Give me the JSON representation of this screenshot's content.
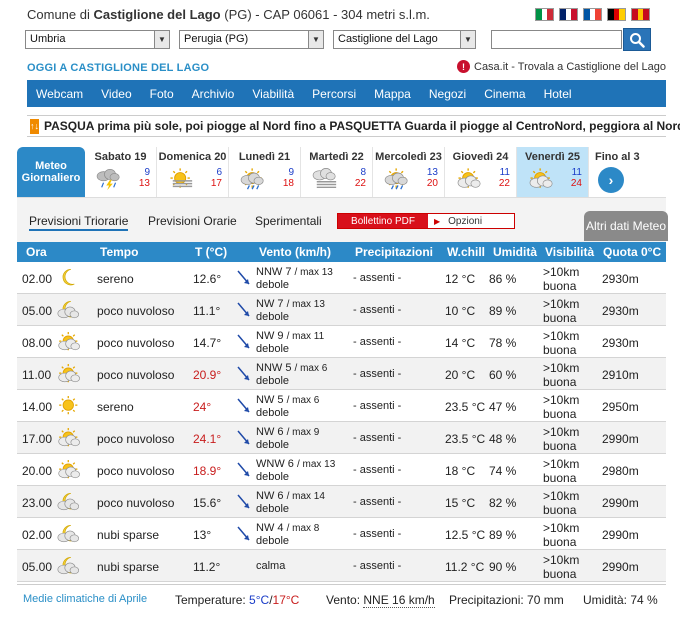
{
  "header": {
    "comune_prefix": "Comune di",
    "comune_name": "Castiglione del Lago",
    "suffix": "(PG) - CAP 06061 - 304 metri s.l.m."
  },
  "flags": [
    {
      "name": "italian-flag",
      "colors": [
        "#009246",
        "#ffffff",
        "#ce2b37"
      ]
    },
    {
      "name": "uk-flag",
      "colors": [
        "#012169",
        "#ffffff",
        "#c8102e"
      ]
    },
    {
      "name": "french-flag",
      "colors": [
        "#0055a4",
        "#ffffff",
        "#ef4135"
      ]
    },
    {
      "name": "german-flag",
      "colors": [
        "#000000",
        "#dd0000",
        "#ffce00"
      ]
    },
    {
      "name": "spanish-flag",
      "colors": [
        "#c60b1e",
        "#ffc400",
        "#c60b1e"
      ]
    }
  ],
  "selects": {
    "region": "Umbria",
    "province": "Perugia (PG)",
    "comune": "Castiglione del Lago"
  },
  "search": {
    "value": ""
  },
  "oggi_title": "OGGI A CASTIGLIONE DEL LAGO",
  "casa_link": "Casa.it - Trovala a Castiglione del Lago",
  "nav": [
    "Webcam",
    "Video",
    "Foto",
    "Archivio",
    "Viabilità",
    "Percorsi",
    "Mappa",
    "Negozi",
    "Cinema",
    "Hotel"
  ],
  "news": {
    "text": "PASQUA prima più sole, poi piogge al Nord fino a PASQUETTA Guarda il piogge al CentroNord, peggiora al Nord"
  },
  "days": {
    "meteo_tab": "Meteo Giornaliero",
    "list": [
      {
        "name": "Sabato 19",
        "min": "9",
        "max": "13",
        "icon": "thunderstorm-icon"
      },
      {
        "name": "Domenica 20",
        "min": "6",
        "max": "17",
        "icon": "sun-fog-icon"
      },
      {
        "name": "Lunedì 21",
        "min": "9",
        "max": "18",
        "icon": "rain-icon"
      },
      {
        "name": "Martedì 22",
        "min": "8",
        "max": "22",
        "icon": "fog-icon"
      },
      {
        "name": "Mercoledì 23",
        "min": "13",
        "max": "20",
        "icon": "rain-icon"
      },
      {
        "name": "Giovedì 24",
        "min": "11",
        "max": "22",
        "icon": "partly-cloudy-icon"
      },
      {
        "name": "Venerdì 25",
        "min": "11",
        "max": "24",
        "icon": "partly-cloudy-icon",
        "selected": true
      }
    ],
    "fino": "Fino al 3"
  },
  "subtabs": {
    "triorarie": "Previsioni Triorarie",
    "orarie": "Previsioni Orarie",
    "sperimentali": "Sperimentali",
    "bollettino": "Bollettino PDF",
    "opzioni": "Opzioni",
    "altri": "Altri dati Meteo"
  },
  "columns": {
    "ora": "Ora",
    "tempo": "Tempo",
    "temp": "T (°C)",
    "vento": "Vento (km/h)",
    "prec": "Precipitazioni",
    "wchill": "W.chill",
    "umidita": "Umidità",
    "visibilita": "Visibilità",
    "quota": "Quota 0°C"
  },
  "rows": [
    {
      "ora": "02.00",
      "icon": "moon-icon",
      "tempo": "sereno",
      "temp": "12.6°",
      "warm": false,
      "dir": "NNW 7",
      "max": "/ max 13",
      "forza": "debole",
      "prec": "- assenti -",
      "wc": "12 °C",
      "umi": "86 %",
      "vis": ">10km",
      "vis2": "buona",
      "quota": "2930m"
    },
    {
      "ora": "05.00",
      "icon": "cloudy-moon-icon",
      "tempo": "poco nuvoloso",
      "temp": "11.1°",
      "warm": false,
      "dir": "NW 7",
      "max": "/ max 13",
      "forza": "debole",
      "prec": "- assenti -",
      "wc": "10 °C",
      "umi": "89 %",
      "vis": ">10km",
      "vis2": "buona",
      "quota": "2930m"
    },
    {
      "ora": "08.00",
      "icon": "partly-cloudy-icon",
      "tempo": "poco nuvoloso",
      "temp": "14.7°",
      "warm": false,
      "dir": "NW 9",
      "max": "/ max 11",
      "forza": "debole",
      "prec": "- assenti -",
      "wc": "14 °C",
      "umi": "78 %",
      "vis": ">10km",
      "vis2": "buona",
      "quota": "2930m"
    },
    {
      "ora": "11.00",
      "icon": "partly-cloudy-icon",
      "tempo": "poco nuvoloso",
      "temp": "20.9°",
      "warm": true,
      "dir": "NNW 5",
      "max": "/ max 6",
      "forza": "debole",
      "prec": "- assenti -",
      "wc": "20 °C",
      "umi": "60 %",
      "vis": ">10km",
      "vis2": "buona",
      "quota": "2910m"
    },
    {
      "ora": "14.00",
      "icon": "sun-icon",
      "tempo": "sereno",
      "temp": "24°",
      "warm": true,
      "dir": "NW 5",
      "max": "/ max 6",
      "forza": "debole",
      "prec": "- assenti -",
      "wc": "23.5 °C",
      "umi": "47 %",
      "vis": ">10km",
      "vis2": "buona",
      "quota": "2950m"
    },
    {
      "ora": "17.00",
      "icon": "partly-cloudy-icon",
      "tempo": "poco nuvoloso",
      "temp": "24.1°",
      "warm": true,
      "dir": "NW 6",
      "max": "/ max 9",
      "forza": "debole",
      "prec": "- assenti -",
      "wc": "23.5 °C",
      "umi": "48 %",
      "vis": ">10km",
      "vis2": "buona",
      "quota": "2990m"
    },
    {
      "ora": "20.00",
      "icon": "partly-cloudy-icon",
      "tempo": "poco nuvoloso",
      "temp": "18.9°",
      "warm": true,
      "dir": "WNW 6",
      "max": "/ max 13",
      "forza": "debole",
      "prec": "- assenti -",
      "wc": "18 °C",
      "umi": "74 %",
      "vis": ">10km",
      "vis2": "buona",
      "quota": "2980m"
    },
    {
      "ora": "23.00",
      "icon": "cloudy-moon-icon",
      "tempo": "poco nuvoloso",
      "temp": "15.6°",
      "warm": false,
      "dir": "NW 6",
      "max": "/ max 14",
      "forza": "debole",
      "prec": "- assenti -",
      "wc": "15 °C",
      "umi": "82 %",
      "vis": ">10km",
      "vis2": "buona",
      "quota": "2990m"
    },
    {
      "ora": "02.00",
      "icon": "cloudy-moon-icon",
      "tempo": "nubi sparse",
      "temp": "13°",
      "warm": false,
      "dir": "NW 4",
      "max": "/ max 8",
      "forza": "debole",
      "prec": "- assenti -",
      "wc": "12.5 °C",
      "umi": "89 %",
      "vis": ">10km",
      "vis2": "buona",
      "quota": "2990m"
    },
    {
      "ora": "05.00",
      "icon": "cloudy-moon-icon",
      "tempo": "nubi sparse",
      "temp": "11.2°",
      "warm": false,
      "dir": "",
      "max": "",
      "forza": "calma",
      "prec": "- assenti -",
      "wc": "11.2 °C",
      "umi": "90 %",
      "vis": ">10km",
      "vis2": "buona",
      "quota": "2990m"
    }
  ],
  "footer": {
    "medie": "Medie climatiche di Aprile",
    "temp_label": "Temperature:",
    "tmin": "5°C",
    "sep": "/",
    "tmax": "17°C",
    "vento_label": "Vento:",
    "vento_val": "NNE 16 km/h",
    "prec_label": "Precipitazioni:",
    "prec_val": "70 mm",
    "umi_label": "Umidità:",
    "umi_val": "74 %"
  }
}
